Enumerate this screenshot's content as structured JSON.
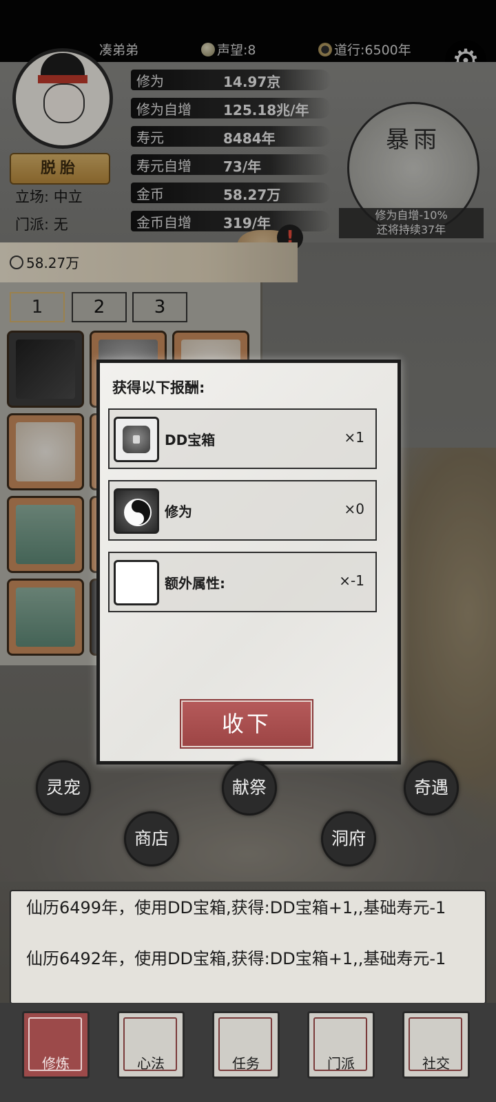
{
  "topbar": {
    "player_name": "凑弟弟",
    "prestige": "声望:8",
    "daoxing": "道行:6500年"
  },
  "profile": {
    "realm": "脱胎",
    "stance": "立场: 中立",
    "sect": "门派: 无"
  },
  "stats": [
    {
      "label": "修为",
      "value": "14.97京"
    },
    {
      "label": "修为自增",
      "value": "125.18兆/年"
    },
    {
      "label": "寿元",
      "value": "8484年"
    },
    {
      "label": "寿元自增",
      "value": "73/年"
    },
    {
      "label": "金币",
      "value": "58.27万"
    },
    {
      "label": "金币自增",
      "value": "319/年"
    }
  ],
  "weather": {
    "name": "暴雨",
    "effect_line1": "修为自增-10%",
    "effect_line2": "还将持续37年"
  },
  "alert_mark": "!",
  "inventory": {
    "gold": "58.27万",
    "tabs": [
      "1",
      "2",
      "3"
    ]
  },
  "modal": {
    "title": "获得以下报酬:",
    "rewards": [
      {
        "name": "DD宝箱",
        "count": "×1",
        "icon": "treasure-chest-icon"
      },
      {
        "name": "修为",
        "count": "×0",
        "icon": "yin-yang-icon"
      },
      {
        "name": "额外属性:",
        "count": "×-1",
        "icon": "blank-icon"
      }
    ],
    "accept_label": "收下"
  },
  "actions": {
    "spirit_pet": "灵宠",
    "sacrifice": "献祭",
    "encounter": "奇遇",
    "shop": "商店",
    "cave": "洞府"
  },
  "log": [
    "仙历6499年，使用DD宝箱,获得:DD宝箱+1,,基础寿元-1",
    "仙历6492年，使用DD宝箱,获得:DD宝箱+1,,基础寿元-1"
  ],
  "nav": {
    "cultivate": "修炼",
    "mental": "心法",
    "task": "任务",
    "sect": "门派",
    "social": "社交"
  },
  "colors": {
    "accent_red": "#9d4545",
    "ink_black": "#111111",
    "paper": "#efeeeb"
  }
}
